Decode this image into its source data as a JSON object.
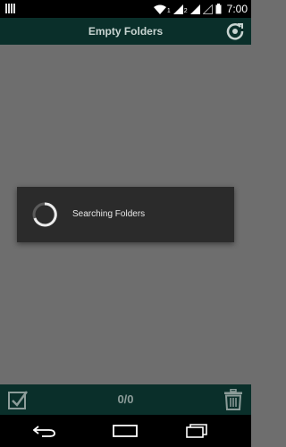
{
  "status_bar": {
    "time": "7:00",
    "sim1": "1",
    "sim2": "2",
    "icons": [
      "notification-icon",
      "wifi-icon",
      "signal-icon",
      "battery-icon"
    ]
  },
  "app_bar": {
    "title": "Empty Folders",
    "refresh_icon": "refresh-icon"
  },
  "dialog": {
    "message": "Searching Folders"
  },
  "bottom_bar": {
    "count": "0/0",
    "select_all_icon": "checkbox-icon",
    "delete_icon": "trash-icon"
  },
  "nav_bar": {
    "icons": [
      "back-icon",
      "home-icon",
      "recents-icon"
    ]
  },
  "colors": {
    "app_bar": "#0a2f2a",
    "content_bg": "#6e6e6e",
    "dialog_bg": "#2b2b2b",
    "icon_tint": "#8c9c99"
  }
}
